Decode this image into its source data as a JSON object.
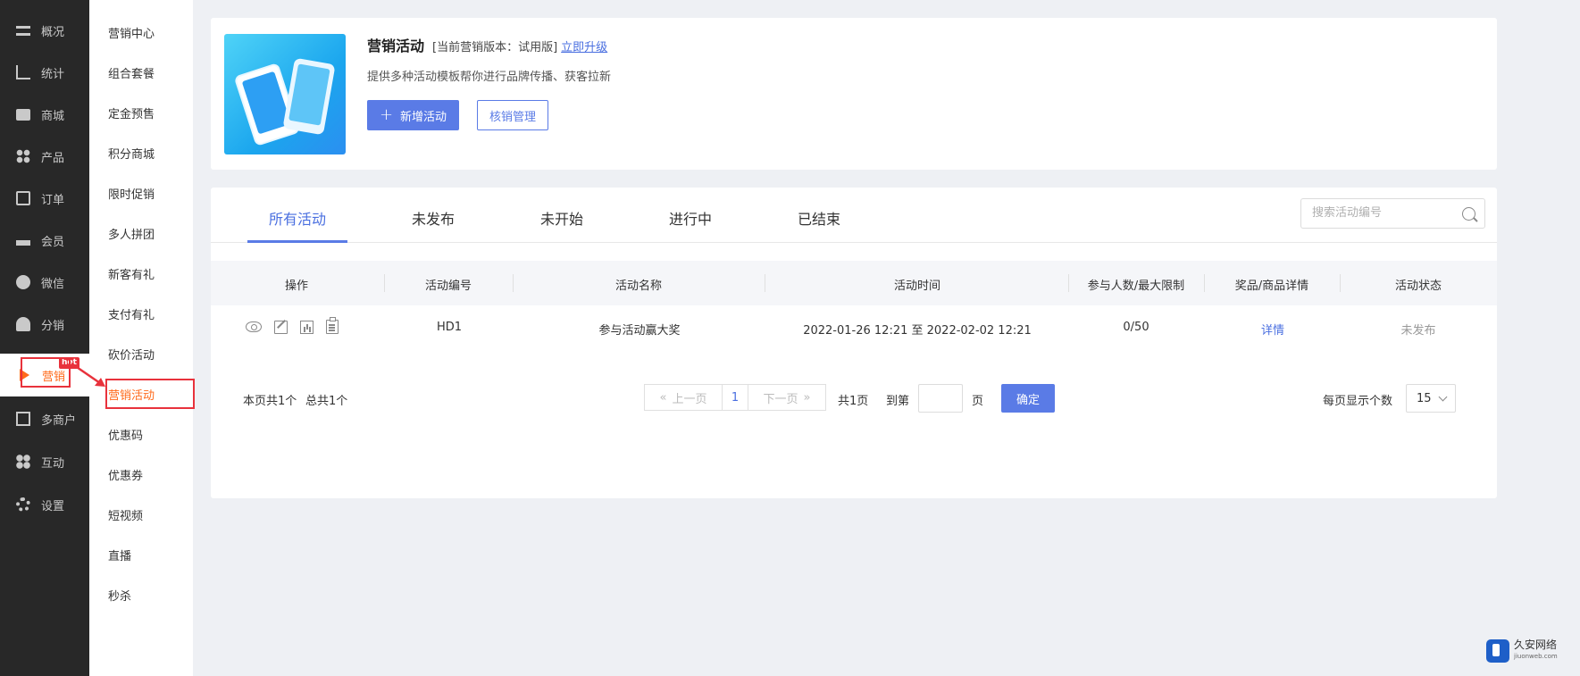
{
  "nav": {
    "items": [
      {
        "label": "概况",
        "icon": "layers-icon"
      },
      {
        "label": "统计",
        "icon": "stats-icon"
      },
      {
        "label": "商城",
        "icon": "shop-icon"
      },
      {
        "label": "产品",
        "icon": "grid-icon"
      },
      {
        "label": "订单",
        "icon": "order-icon"
      },
      {
        "label": "会员",
        "icon": "crown-icon"
      },
      {
        "label": "微信",
        "icon": "wechat-icon"
      },
      {
        "label": "分销",
        "icon": "users-icon"
      },
      {
        "label": "营销",
        "icon": "play-icon",
        "badge": "hot"
      },
      {
        "label": "多商户",
        "icon": "merchant-icon"
      },
      {
        "label": "互动",
        "icon": "interact-icon"
      },
      {
        "label": "设置",
        "icon": "gear-icon"
      }
    ]
  },
  "subnav": {
    "items": [
      "营销中心",
      "组合套餐",
      "定金预售",
      "积分商城",
      "限时促销",
      "多人拼团",
      "新客有礼",
      "支付有礼",
      "砍价活动",
      "营销活动",
      "优惠码",
      "优惠券",
      "短视频",
      "直播",
      "秒杀"
    ]
  },
  "header": {
    "title": "营销活动",
    "version": "[当前营销版本：试用版]",
    "upgrade_link": "立即升级",
    "description": "提供多种活动模板帮你进行品牌传播、获客拉新",
    "new_button": "新增活动",
    "new_button_icon": "+",
    "verify_button": "核销管理"
  },
  "tabs": [
    "所有活动",
    "未发布",
    "未开始",
    "进行中",
    "已结束"
  ],
  "search": {
    "placeholder": "搜索活动编号"
  },
  "table": {
    "columns": [
      "操作",
      "活动编号",
      "活动名称",
      "活动时间",
      "参与人数/最大限制",
      "奖品/商品详情",
      "活动状态"
    ],
    "rows": [
      {
        "ops": [
          "eye-icon",
          "edit-icon",
          "chart-icon",
          "clipboard-icon"
        ],
        "id": "HD1",
        "name": "参与活动赢大奖",
        "time": "2022-01-26 12:21 至 2022-02-02 12:21",
        "participants": "0/50",
        "detail": "详情",
        "status": "未发布"
      }
    ]
  },
  "pagination": {
    "summary": "本页共1个",
    "total": "总共1个",
    "prev": "上一页",
    "current": "1",
    "next": "下一页",
    "pages": "共1页",
    "goto_label": "到第",
    "page_unit": "页",
    "confirm": "确定",
    "page_size_label": "每页显示个数",
    "page_size": "15"
  },
  "watermark": {
    "name": "久安网络",
    "url": "jiuonweb.com"
  },
  "colors": {
    "primary": "#5a7be6",
    "accent": "#ff6a1a",
    "nav_bg": "#282828",
    "annotation": "#e8323c"
  }
}
